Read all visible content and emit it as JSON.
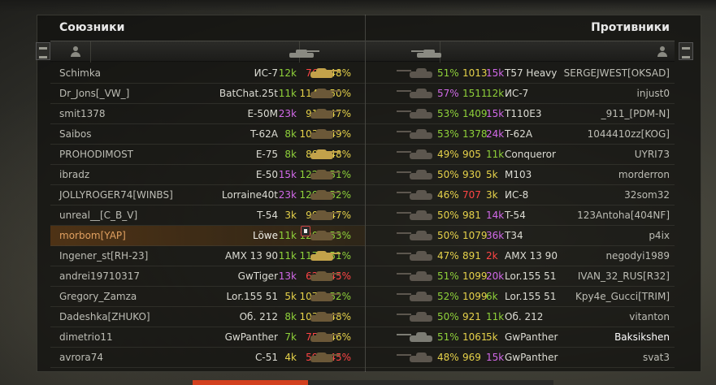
{
  "allies_title": "Союзники",
  "enemies_title": "Противники",
  "colors": {
    "green": "#8fd13a",
    "yellow": "#e6d24a",
    "red": "#ff4545",
    "violet": "#d169e8",
    "white": "#f0f0f0",
    "orange": "#f0a030"
  },
  "allies": [
    {
      "nick": "Schimka",
      "tank": "ИС-7",
      "battles": "12k",
      "battles_c": "green",
      "wn": "761",
      "wn_c": "red",
      "wr": "48%",
      "wr_c": "yellow",
      "status": "alive"
    },
    {
      "nick": "Dr_Jons[_VW_]",
      "tank": "BatChat.25t",
      "battles": "11k",
      "battles_c": "green",
      "wn": "1142",
      "wn_c": "yellow",
      "wr": "50%",
      "wr_c": "yellow",
      "status": "dead"
    },
    {
      "nick": "smit1378",
      "tank": "E-50M",
      "battles": "23k",
      "battles_c": "violet",
      "wn": "915",
      "wn_c": "yellow",
      "wr": "47%",
      "wr_c": "yellow",
      "status": "dead"
    },
    {
      "nick": "Saibos",
      "tank": "T-62A",
      "battles": "8k",
      "battles_c": "green",
      "wn": "1038",
      "wn_c": "yellow",
      "wr": "49%",
      "wr_c": "yellow",
      "status": "dead"
    },
    {
      "nick": "PROHODIMOST",
      "tank": "E-75",
      "battles": "8k",
      "battles_c": "green",
      "wn": "882",
      "wn_c": "yellow",
      "wr": "48%",
      "wr_c": "yellow",
      "status": "alive"
    },
    {
      "nick": "ibradz",
      "tank": "E-50",
      "battles": "15k",
      "battles_c": "violet",
      "wn": "1226",
      "wn_c": "green",
      "wr": "51%",
      "wr_c": "green",
      "status": "dead"
    },
    {
      "nick": "JOLLYROGER74[WINBS]",
      "tank": "Lorraine40t",
      "battles": "23k",
      "battles_c": "violet",
      "wn": "1203",
      "wn_c": "green",
      "wr": "52%",
      "wr_c": "green",
      "status": "dead"
    },
    {
      "nick": "unreal__[C_B_V]",
      "tank": "T-54",
      "battles": "3k",
      "battles_c": "yellow",
      "wn": "906",
      "wn_c": "yellow",
      "wr": "47%",
      "wr_c": "yellow",
      "status": "dead"
    },
    {
      "nick": "morbom[YAP]",
      "tank": "Löwe",
      "battles": "11k",
      "battles_c": "green",
      "wn": "1201",
      "wn_c": "green",
      "wr": "53%",
      "wr_c": "green",
      "status": "dead",
      "highlight": true,
      "platoon": true
    },
    {
      "nick": "Ingener_st[RH-23]",
      "tank": "AMX 13 90",
      "battles": "11k",
      "battles_c": "green",
      "wn": "1170",
      "wn_c": "green",
      "wr": "51%",
      "wr_c": "green",
      "status": "alive"
    },
    {
      "nick": "andrei19710317",
      "tank": "GwTiger",
      "battles": "13k",
      "battles_c": "violet",
      "wn": "628",
      "wn_c": "red",
      "wr": "45%",
      "wr_c": "red",
      "status": "dead"
    },
    {
      "nick": "Gregory_Zamza",
      "tank": "Lor.155 51",
      "battles": "5k",
      "battles_c": "yellow",
      "wn": "1071",
      "wn_c": "yellow",
      "wr": "52%",
      "wr_c": "green",
      "status": "dead"
    },
    {
      "nick": "Dadeshka[ZHUKO]",
      "tank": "Об. 212",
      "battles": "8k",
      "battles_c": "green",
      "wn": "1035",
      "wn_c": "yellow",
      "wr": "48%",
      "wr_c": "yellow",
      "status": "dead"
    },
    {
      "nick": "dimetrio11",
      "tank": "GwPanther",
      "battles": "7k",
      "battles_c": "green",
      "wn": "756",
      "wn_c": "red",
      "wr": "46%",
      "wr_c": "yellow",
      "status": "dead"
    },
    {
      "nick": "avrora74",
      "tank": "C-51",
      "battles": "4k",
      "battles_c": "yellow",
      "wn": "597",
      "wn_c": "red",
      "wr": "45%",
      "wr_c": "red",
      "status": "dead"
    }
  ],
  "enemies": [
    {
      "wr": "51%",
      "wr_c": "green",
      "wn": "1013",
      "wn_c": "yellow",
      "battles": "15k",
      "battles_c": "violet",
      "tank": "T57 Heavy",
      "nick": "SERGEJWEST[OKSAD]",
      "status": "dead"
    },
    {
      "wr": "57%",
      "wr_c": "violet",
      "wn": "1511",
      "wn_c": "green",
      "battles": "12k",
      "battles_c": "green",
      "tank": "ИС-7",
      "nick": "injust0",
      "status": "dead"
    },
    {
      "wr": "53%",
      "wr_c": "green",
      "wn": "1409",
      "wn_c": "green",
      "battles": "15k",
      "battles_c": "violet",
      "tank": "T110E3",
      "nick": "_911_[PDM-N]",
      "status": "dead"
    },
    {
      "wr": "53%",
      "wr_c": "green",
      "wn": "1378",
      "wn_c": "green",
      "battles": "24k",
      "battles_c": "violet",
      "tank": "T-62A",
      "nick": "1044410zz[KOG]",
      "status": "dead"
    },
    {
      "wr": "49%",
      "wr_c": "yellow",
      "wn": "905",
      "wn_c": "yellow",
      "battles": "11k",
      "battles_c": "green",
      "tank": "Conqueror",
      "nick": "UYRI73",
      "status": "dead"
    },
    {
      "wr": "50%",
      "wr_c": "yellow",
      "wn": "930",
      "wn_c": "yellow",
      "battles": "5k",
      "battles_c": "yellow",
      "tank": "M103",
      "nick": "morderron",
      "status": "dead"
    },
    {
      "wr": "46%",
      "wr_c": "yellow",
      "wn": "707",
      "wn_c": "red",
      "battles": "3k",
      "battles_c": "yellow",
      "tank": "ИС-8",
      "nick": "32som32",
      "status": "dead"
    },
    {
      "wr": "50%",
      "wr_c": "yellow",
      "wn": "981",
      "wn_c": "yellow",
      "battles": "14k",
      "battles_c": "violet",
      "tank": "T-54",
      "nick": "123Antoha[404NF]",
      "status": "dead"
    },
    {
      "wr": "50%",
      "wr_c": "yellow",
      "wn": "1079",
      "wn_c": "yellow",
      "battles": "36k",
      "battles_c": "violet",
      "tank": "T34",
      "nick": "p4ix",
      "status": "dead"
    },
    {
      "wr": "47%",
      "wr_c": "yellow",
      "wn": "891",
      "wn_c": "yellow",
      "battles": "2k",
      "battles_c": "red",
      "tank": "AMX 13 90",
      "nick": "negodyi1989",
      "status": "dead"
    },
    {
      "wr": "51%",
      "wr_c": "green",
      "wn": "1099",
      "wn_c": "yellow",
      "battles": "20k",
      "battles_c": "violet",
      "tank": "Lor.155 51",
      "nick": "IVAN_32_RUS[R32]",
      "status": "dead"
    },
    {
      "wr": "52%",
      "wr_c": "green",
      "wn": "1099",
      "wn_c": "yellow",
      "battles": "6k",
      "battles_c": "green",
      "tank": "Lor.155 51",
      "nick": "Kpy4e_Gucci[TRIM]",
      "status": "dead"
    },
    {
      "wr": "50%",
      "wr_c": "green",
      "wn": "921",
      "wn_c": "yellow",
      "battles": "11k",
      "battles_c": "green",
      "tank": "Об. 212",
      "nick": "vitanton",
      "status": "dead"
    },
    {
      "wr": "51%",
      "wr_c": "green",
      "wn": "1061",
      "wn_c": "yellow",
      "battles": "5k",
      "battles_c": "yellow",
      "tank": "GwPanther",
      "nick": "Baksikshen",
      "status": "alive",
      "bright": true
    },
    {
      "wr": "48%",
      "wr_c": "yellow",
      "wn": "969",
      "wn_c": "yellow",
      "battles": "15k",
      "battles_c": "violet",
      "tank": "GwPanther",
      "nick": "svat3",
      "status": "dead"
    }
  ],
  "progress_fraction": 0.32
}
